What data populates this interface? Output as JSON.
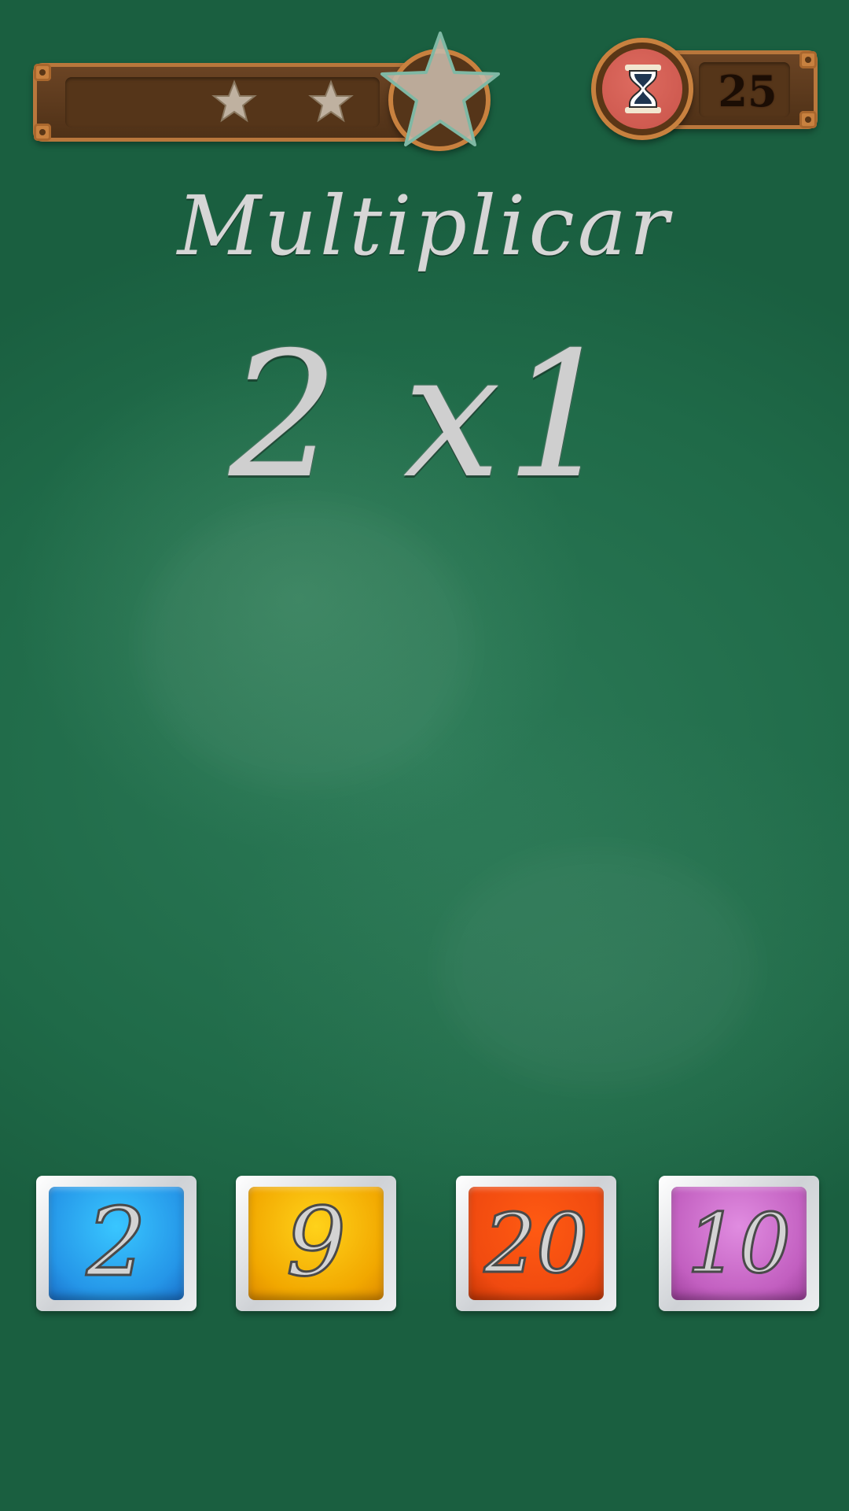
{
  "game": {
    "title": "Multiplicar",
    "equation": "2 x1"
  },
  "progress": {
    "stars_total": 3,
    "stars_shown": 3,
    "star_icons": [
      "star-icon",
      "star-icon",
      "star-icon"
    ]
  },
  "timer": {
    "value": "25",
    "icon": "hourglass-icon",
    "circle_color": "#c9544a"
  },
  "answers": [
    {
      "label": "2",
      "color": "#2fa8f0"
    },
    {
      "label": "9",
      "color": "#f0a800"
    },
    {
      "label": "20",
      "color": "#f04a10"
    },
    {
      "label": "10",
      "color": "#c25fc0"
    }
  ],
  "colors": {
    "board": "#21704b",
    "wood": "#553519",
    "wood_trim": "#c8813f",
    "chalk": "#d6d6d6"
  }
}
